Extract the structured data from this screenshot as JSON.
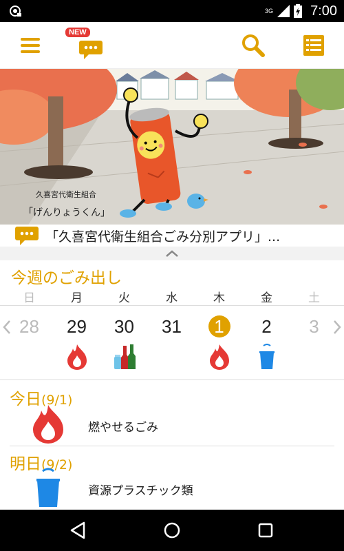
{
  "status_bar": {
    "time": "7:00",
    "network": "3G"
  },
  "toolbar": {
    "new_badge": "NEW"
  },
  "hero": {
    "organization": "久喜宮代衛生組合",
    "mascot_name": "「げんりょうくん」"
  },
  "news": {
    "text": "「久喜宮代衛生組合ごみ分別アプリ」..."
  },
  "week": {
    "title": "今週のごみ出し",
    "weekdays": [
      "日",
      "月",
      "火",
      "水",
      "木",
      "金",
      "土"
    ],
    "dates": [
      {
        "num": "28",
        "dim": true,
        "icon": ""
      },
      {
        "num": "29",
        "dim": false,
        "icon": "fire-icon"
      },
      {
        "num": "30",
        "dim": false,
        "icon": "bottles-icon"
      },
      {
        "num": "31",
        "dim": false,
        "icon": ""
      },
      {
        "num": "1",
        "dim": false,
        "today": true,
        "icon": "fire-icon"
      },
      {
        "num": "2",
        "dim": false,
        "icon": "bucket-icon"
      },
      {
        "num": "3",
        "dim": true,
        "icon": ""
      }
    ]
  },
  "today": {
    "label": "今日",
    "date": "(9/1)",
    "item": "燃やせるごみ"
  },
  "tomorrow": {
    "label": "明日",
    "date": "(9/2)",
    "item": "資源プラスチック類"
  },
  "colors": {
    "accent": "#e0a100",
    "fire": "#e53935",
    "bucket": "#1e88e5"
  }
}
